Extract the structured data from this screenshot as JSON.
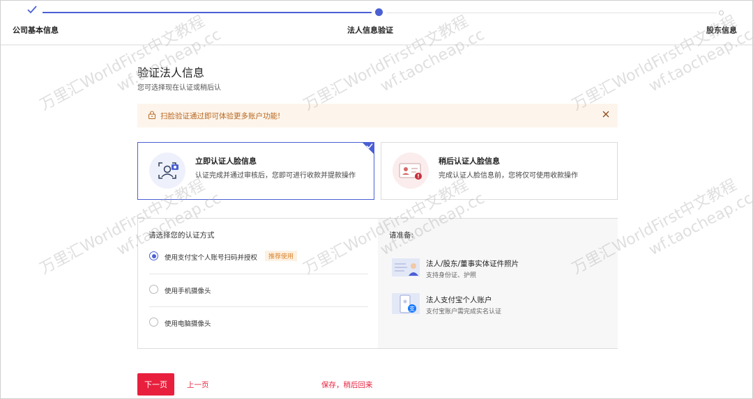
{
  "stepper": {
    "steps": [
      {
        "label": "公司基本信息",
        "state": "done"
      },
      {
        "label": "法人信息验证",
        "state": "active"
      },
      {
        "label": "股东信息",
        "state": "todo"
      }
    ]
  },
  "header": {
    "title": "验证法人信息",
    "subtitle": "您可选择现在认证或稍后认"
  },
  "alert": {
    "text": "扫脸验证通过即可体验更多账户功能!"
  },
  "cards": {
    "now": {
      "title": "立即认证人脸信息",
      "desc": "认证完成并通过审核后，您即可进行收款并提款操作",
      "selected": true
    },
    "later": {
      "title": "稍后认证人脸信息",
      "desc": "完成认证人脸信息前，您将仅可使用收款操作",
      "selected": false
    }
  },
  "method": {
    "heading": "请选择您的认证方式",
    "options": [
      {
        "label": "使用支付宝个人账号扫码并授权",
        "badge": "推荐使用",
        "selected": true
      },
      {
        "label": "使用手机摄像头",
        "selected": false
      },
      {
        "label": "使用电脑摄像头",
        "selected": false
      }
    ]
  },
  "prepare": {
    "heading": "请准备:",
    "items": [
      {
        "title": "法人/股东/董事实体证件照片",
        "sub": "支持身份证、护照"
      },
      {
        "title": "法人支付宝个人账户",
        "sub": "支付宝账户需完成实名认证"
      }
    ]
  },
  "footer": {
    "next": "下一页",
    "prev": "上一页",
    "save": "保存，稍后回来"
  },
  "watermark": {
    "line1": "万里汇WorldFirst中文教程",
    "line2": "wf.taocheap.cc"
  },
  "colors": {
    "accent": "#4a5fd4",
    "primary_red": "#e8203d",
    "alert_bg": "#fdf5ec",
    "alert_text": "#b8671f"
  }
}
